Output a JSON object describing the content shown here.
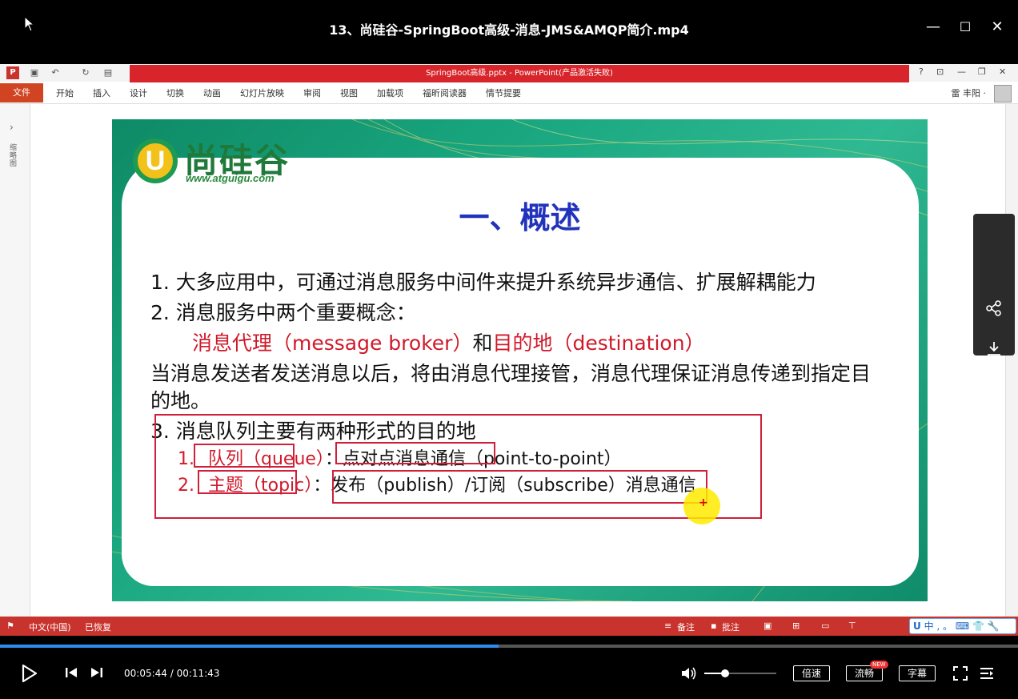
{
  "player": {
    "title": "13、尚硅谷-SpringBoot高级-消息-JMS&AMQP简介.mp4",
    "minimize": "—",
    "maximize": "☐",
    "close": "✕",
    "progress_fraction": 0.49,
    "time_current": "00:05:44",
    "time_total": "00:11:43",
    "separator": "/",
    "volume_fraction": 0.29,
    "speed_label": "倍速",
    "quality_label": "流畅",
    "new_badge": "NEW",
    "subtitle_label": "字幕"
  },
  "powerpoint": {
    "window_title": "SpringBoot高级.pptx - PowerPoint(产品激活失败)",
    "file_tab": "文件",
    "tabs": [
      "开始",
      "插入",
      "设计",
      "切换",
      "动画",
      "幻灯片放映",
      "审阅",
      "视图",
      "加载项",
      "福昕阅读器",
      "情节提要"
    ],
    "user": "雷 丰阳 ·",
    "help": "?",
    "left_pane_label": "缩略图",
    "status": {
      "language": "中文(中国)",
      "recovered": "已恢复",
      "notes": "备注",
      "comments": "批注",
      "ime": "中 ‚ 。 ⌨ 👕 🔧"
    }
  },
  "slide": {
    "logo_text": "尚硅谷",
    "logo_url": "www.atguigu.com",
    "heading": "一、概述",
    "item1": "1.  大多应用中，可通过消息服务中间件来提升系统异步通信、扩展解耦能力",
    "item2": "2.  消息服务中两个重要概念：",
    "concept_a": "消息代理（message broker）",
    "concept_and": "和",
    "concept_b": "目的地（destination）",
    "desc_line1": "当消息发送者发送消息以后，将由消息代理接管，消息代理保证消息传递到指定目",
    "desc_line2": "的地。",
    "item3": "3.  消息队列主要有两种形式的目的地",
    "sub1_num": "1.",
    "sub1_label": "队列（queue）",
    "sub1_desc": "：点对点消息通信（point-to-point）",
    "sub2_num": "2.",
    "sub2_label": "主题（topic）",
    "sub2_desc": "：发布（publish）/订阅（subscribe）消息通信"
  },
  "icons": {
    "share": "share-icon",
    "download": "download-icon",
    "delete": "trash-icon",
    "play": "play-icon",
    "prev": "previous-icon",
    "next": "next-icon",
    "volume": "volume-icon",
    "fullscreen": "fullscreen-icon",
    "playlist": "playlist-icon"
  },
  "colors": {
    "accent_blue": "#2d8cf0",
    "ppt_red": "#c9332d",
    "slide_red": "#d0192a",
    "heading_blue": "#2233bb"
  }
}
